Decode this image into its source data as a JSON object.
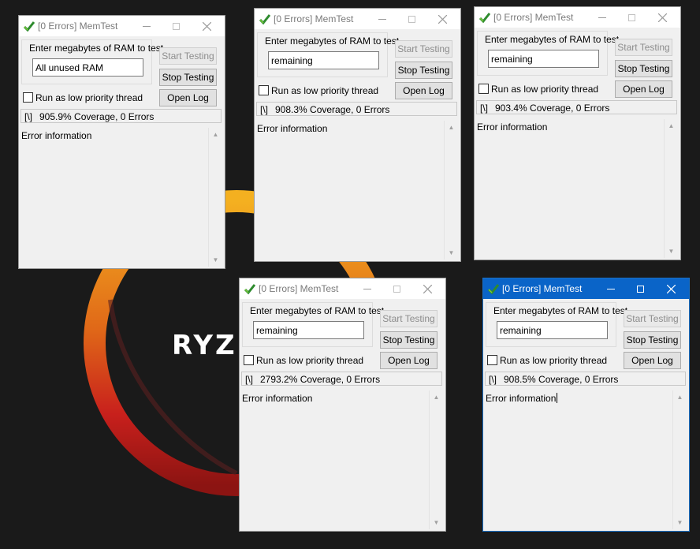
{
  "desktop": {
    "brand_text": "RYZ"
  },
  "windows": [
    {
      "title": "[0 Errors] MemTest",
      "ram_label": "Enter megabytes of RAM to test",
      "ram_value": "All unused RAM",
      "start_label": "Start Testing",
      "stop_label": "Stop Testing",
      "log_label": "Open Log",
      "priority_label": "Run as low priority thread",
      "spinner": "[\\]",
      "coverage": "905.9% Coverage, 0 Errors",
      "error_label": "Error information"
    },
    {
      "title": "[0 Errors] MemTest",
      "ram_label": "Enter megabytes of RAM to test",
      "ram_value": "remaining",
      "start_label": "Start Testing",
      "stop_label": "Stop Testing",
      "log_label": "Open Log",
      "priority_label": "Run as low priority thread",
      "spinner": "[\\]",
      "coverage": "908.3% Coverage, 0 Errors",
      "error_label": "Error information"
    },
    {
      "title": "[0 Errors] MemTest",
      "ram_label": "Enter megabytes of RAM to test",
      "ram_value": "remaining",
      "start_label": "Start Testing",
      "stop_label": "Stop Testing",
      "log_label": "Open Log",
      "priority_label": "Run as low priority thread",
      "spinner": "[\\]",
      "coverage": "903.4% Coverage, 0 Errors",
      "error_label": "Error information"
    },
    {
      "title": "[0 Errors] MemTest",
      "ram_label": "Enter megabytes of RAM to test",
      "ram_value": "remaining",
      "start_label": "Start Testing",
      "stop_label": "Stop Testing",
      "log_label": "Open Log",
      "priority_label": "Run as low priority thread",
      "spinner": "[\\]",
      "coverage": "2793.2% Coverage, 0 Errors",
      "error_label": "Error information"
    },
    {
      "title": "[0 Errors] MemTest",
      "ram_label": "Enter megabytes of RAM to test",
      "ram_value": "remaining",
      "start_label": "Start Testing",
      "stop_label": "Stop Testing",
      "log_label": "Open Log",
      "priority_label": "Run as low priority thread",
      "spinner": "[\\]",
      "coverage": "908.5% Coverage, 0 Errors",
      "error_label": "Error information"
    }
  ],
  "colors": {
    "active_titlebar": "#0a64c8",
    "window_bg": "#f0f0f0",
    "desktop_bg": "#1a1a1a",
    "ring_orange": "#f0a020",
    "ring_red": "#c0201a"
  },
  "icons": {
    "app": "memtest-check-icon",
    "minimize": "minimize-icon",
    "maximize": "maximize-icon",
    "close": "close-icon",
    "scroll_up": "scroll-up-arrow-icon",
    "scroll_down": "scroll-down-arrow-icon"
  }
}
